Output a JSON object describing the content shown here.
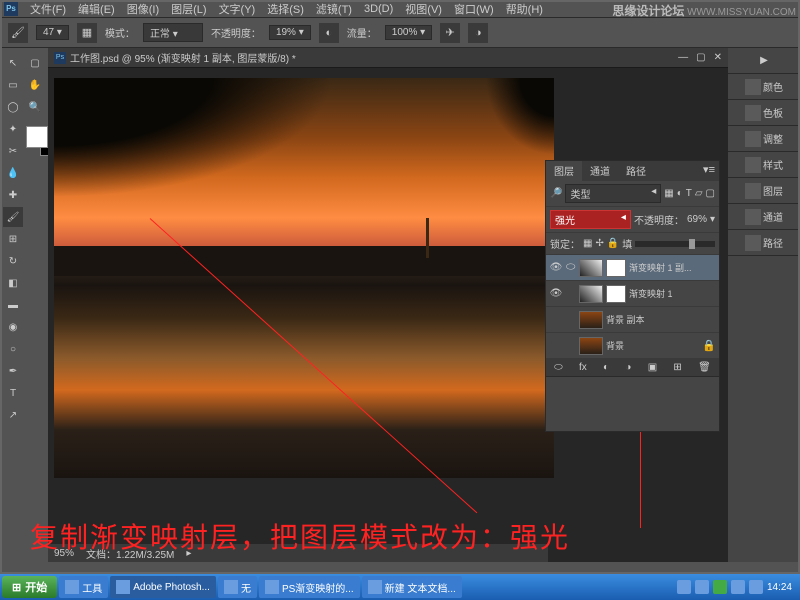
{
  "menubar": {
    "items": [
      "文件(F)",
      "编辑(E)",
      "图像(I)",
      "图层(L)",
      "文字(Y)",
      "选择(S)",
      "滤镜(T)",
      "3D(D)",
      "视图(V)",
      "窗口(W)",
      "帮助(H)"
    ]
  },
  "watermark": {
    "title": "思缘设计论坛",
    "url": "WWW.MISSYUAN.COM"
  },
  "options": {
    "brush_size": "47",
    "mode_label": "模式：",
    "mode_value": "正常",
    "opacity_label": "不透明度：",
    "opacity_value": "19%",
    "flow_label": "流量：",
    "flow_value": "100%"
  },
  "document": {
    "tab_title": "工作图.psd @ 95% (渐变映射 1 副本, 图层蒙版/8) *",
    "zoom": "95%",
    "doc_size_label": "文档：",
    "doc_size": "1.22M/3.25M"
  },
  "right_dock": {
    "items": [
      "颜色",
      "色板",
      "调整",
      "样式",
      "图层",
      "通道",
      "路径"
    ]
  },
  "layers_panel": {
    "tabs": [
      "图层",
      "通道",
      "路径"
    ],
    "type_filter": "类型",
    "blend_mode": "强光",
    "opacity_label": "不透明度：",
    "opacity_value": "69%",
    "lock_label": "锁定：",
    "fill_label": "填",
    "layers": [
      {
        "name": "渐变映射 1 副...",
        "visible": true,
        "selected": true,
        "adj": true
      },
      {
        "name": "渐变映射 1",
        "visible": true,
        "adj": true
      },
      {
        "name": "背景 副本",
        "visible": false
      },
      {
        "name": "背景",
        "visible": false,
        "locked": true
      }
    ],
    "footer_icons": [
      "fx",
      "◐",
      "▭",
      "◑",
      "▣",
      "⊞",
      "🗑"
    ]
  },
  "annotation": {
    "text": "复制渐变映射层，把图层模式改为：强光"
  },
  "taskbar": {
    "start": "开始",
    "items": [
      "工具",
      "Adobe Photosh...",
      "无",
      "PS渐变映射的...",
      "新建 文本文档..."
    ],
    "active_index": 1,
    "time": "14:24"
  }
}
